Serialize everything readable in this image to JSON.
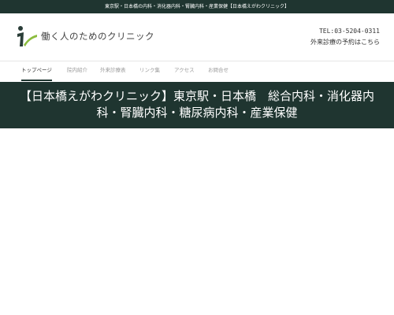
{
  "topbar": {
    "text": "東京駅・日本橋の内科・消化器内科・腎臓内科・産業保健【日本橋えがわクリニック】"
  },
  "header": {
    "logo_icon": "running-person-logo-icon",
    "logo_text": "働く人のためのクリニック",
    "tel": "TEL:03-5204-0311",
    "reservation": "外来診療の予約はこちら"
  },
  "nav": {
    "items": [
      {
        "label": "トップページ",
        "active": true
      },
      {
        "label": "院内紹介",
        "active": false
      },
      {
        "label": "外来診療表",
        "active": false
      },
      {
        "label": "リンク集",
        "active": false
      },
      {
        "label": "アクセス",
        "active": false
      },
      {
        "label": "お問合せ",
        "active": false
      }
    ]
  },
  "hero": {
    "title": "【日本橋えがわクリニック】東京駅・日本橋　総合内科・消化器内科・腎臓内科・糖尿病内科・産業保健"
  },
  "colors": {
    "brand_dark_green": "#1f3530",
    "nav_inactive": "#999999",
    "nav_active": "#333333"
  }
}
